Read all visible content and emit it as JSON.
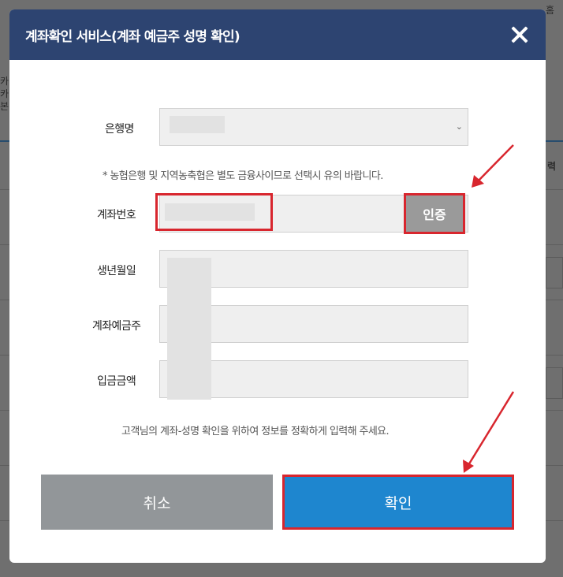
{
  "background": {
    "top_right_text": "홈",
    "side_text": [
      "카",
      "카",
      "본"
    ],
    "right_text": "력"
  },
  "modal": {
    "title": "계좌확인 서비스(계좌 예금주 성명 확인)",
    "close_icon": "close-icon",
    "fields": {
      "bank": {
        "label": "은행명"
      },
      "account": {
        "label": "계좌번호",
        "auth_button": "인증"
      },
      "birth": {
        "label": "생년월일"
      },
      "holder": {
        "label": "계좌예금주"
      },
      "amount": {
        "label": "입금금액"
      }
    },
    "bank_notice": "* 농협은행 및 지역농축협은 별도 금융사이므로 선택시 유의 바랍니다.",
    "bottom_notice": "고객님의 계좌-성명 확인을 위하여 정보를 정확하게 입력해 주세요.",
    "buttons": {
      "cancel": "취소",
      "confirm": "확인"
    }
  },
  "colors": {
    "header": "#2d4471",
    "confirm": "#1e86cf",
    "cancel": "#929699",
    "highlight": "#d8262e"
  }
}
